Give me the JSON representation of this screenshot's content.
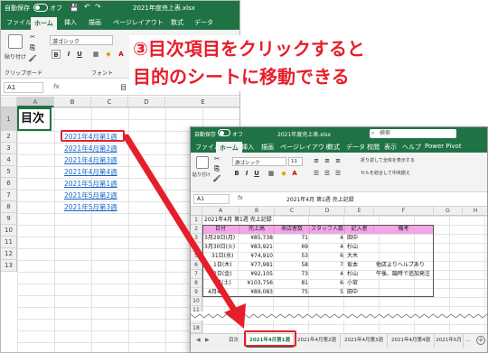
{
  "annotation": {
    "line1": "③目次項目をクリックすると",
    "line2": "目的のシートに移動できる"
  },
  "back_window": {
    "autosave_label": "自動保存",
    "autosave_state": "オフ",
    "title": "2021年度売上表.xlsx",
    "tabs": [
      "ファイル",
      "ホーム",
      "挿入",
      "描画",
      "ページレイアウト",
      "数式",
      "データ"
    ],
    "active_tab": "ホーム",
    "ribbon": {
      "paste_label": "貼り付け",
      "clipboard_label": "クリップボード",
      "font_name": "游ゴシック",
      "bold": "B",
      "font_group_label": "フォント"
    },
    "name_box": "A1",
    "fx": "fx",
    "formula_text": "目",
    "columns": [
      "A",
      "B",
      "C",
      "D",
      "E"
    ],
    "rows": [
      "1",
      "2",
      "3",
      "4",
      "5",
      "6",
      "7",
      "8",
      "9",
      "10",
      "11",
      "12",
      "13"
    ],
    "a1_value": "目次",
    "links": [
      "2021年4月第1週",
      "2021年4月第2週",
      "2021年4月第3週",
      "2021年4月第4週",
      "2021年5月第1週",
      "2021年5月第2週",
      "2021年5月第3週"
    ]
  },
  "front_window": {
    "autosave_label": "自動保存",
    "autosave_state": "オフ",
    "title": "2021年度売上表.xlsx",
    "search_placeholder": "検索",
    "tabs": [
      "ファイル",
      "ホーム",
      "挿入",
      "描画",
      "ページレイアウト",
      "数式",
      "データ",
      "校閲",
      "表示",
      "ヘルプ",
      "Power Pivot"
    ],
    "active_tab": "ホーム",
    "ribbon": {
      "paste_label": "貼り付け",
      "font_name": "游ゴシック",
      "font_size": "11",
      "wrap_label": "折り返して全体を表示する",
      "merge_label": "セルを結合して中央揃え",
      "bold": "B",
      "italic": "I",
      "underline": "U"
    },
    "name_box": "A1",
    "fx": "fx",
    "formula_text": "2021年4月 第1週 売上記録",
    "columns": [
      "A",
      "B",
      "C",
      "D",
      "E",
      "F",
      "G",
      "H"
    ],
    "rows": [
      "1",
      "2",
      "3",
      "4",
      "5",
      "6",
      "7",
      "8",
      "9",
      "10",
      "11",
      "17",
      "18"
    ],
    "title_cell": "2021年4月 第1週 売上記録",
    "headers": [
      "日付",
      "売上高",
      "来店者数",
      "スタッフ人数",
      "記入者",
      "備考"
    ],
    "data_rows": [
      {
        "date": "3月29日(月)",
        "sales": "¥85,738",
        "visitors": "71",
        "staff": "4",
        "writer": "田中",
        "note": ""
      },
      {
        "date": "3月30日(火)",
        "sales": "¥83,921",
        "visitors": "69",
        "staff": "4",
        "writer": "杉山",
        "note": ""
      },
      {
        "date": "31日(水)",
        "sales": "¥74,910",
        "visitors": "53",
        "staff": "6",
        "writer": "大木",
        "note": ""
      },
      {
        "date": "1日(木)",
        "sales": "¥77,981",
        "visitors": "58",
        "staff": "7",
        "writer": "坂本",
        "note": "他店よりヘルプあり"
      },
      {
        "date": "2日(金)",
        "sales": "¥92,105",
        "visitors": "73",
        "staff": "4",
        "writer": "杉山",
        "note": "午後、臨時で追加発注"
      },
      {
        "date": "日(土)",
        "sales": "¥103,756",
        "visitors": "81",
        "staff": "6",
        "writer": "小宮",
        "note": ""
      },
      {
        "date": "4月4日",
        "sales": "¥89,083",
        "visitors": "75",
        "staff": "5",
        "writer": "田中",
        "note": ""
      }
    ],
    "sheet_tabs": [
      "目次",
      "2021年4月第1週",
      "2021年4月第2週",
      "2021年4月第3週",
      "2021年4月第4週",
      "2021年5月"
    ],
    "active_sheet": "2021年4月第1週",
    "nav_prev": "◀",
    "nav_next": "▶",
    "more": "...",
    "add_sheet": "+"
  },
  "colors": {
    "excel_green": "#1f7244",
    "annotation_red": "#e61e2b",
    "header_pink": "#f3a6e5",
    "link_blue": "#1466c8"
  }
}
